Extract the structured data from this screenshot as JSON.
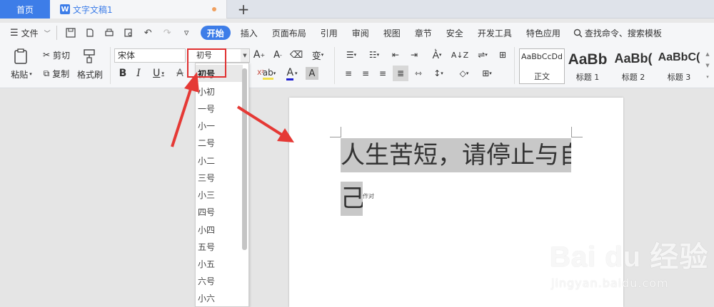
{
  "tabbar": {
    "home_label": "首页",
    "doc_icon_letter": "W",
    "doc_title": "文字文稿1",
    "new_tab_glyph": "+"
  },
  "menubar": {
    "file_label": "文件",
    "items": [
      "开始",
      "插入",
      "页面布局",
      "引用",
      "审阅",
      "视图",
      "章节",
      "安全",
      "开发工具",
      "特色应用"
    ],
    "active_item": "开始",
    "search_label": "查找命令、搜索模板"
  },
  "ribbon": {
    "paste_label": "粘贴",
    "cut_label": "剪切",
    "copy_label": "复制",
    "format_painter_label": "格式刷",
    "font_name": "宋体",
    "font_size": "初号",
    "styles": [
      {
        "sample": "AaBbCcDd",
        "name": "正文"
      },
      {
        "sample": "AaBb",
        "name": "标题 1"
      },
      {
        "sample": "AaBb(",
        "name": "标题 2"
      },
      {
        "sample": "AaBbC(",
        "name": "标题 3"
      }
    ]
  },
  "font_size_dropdown": {
    "options": [
      "初号",
      "小初",
      "一号",
      "小一",
      "二号",
      "小二",
      "三号",
      "小三",
      "四号",
      "小四",
      "五号",
      "小五",
      "六号",
      "小六"
    ],
    "selected": "初号"
  },
  "document": {
    "line1": "人生苦短，请停止与自",
    "line2": "己",
    "small_tag": "作对"
  },
  "watermark": {
    "brand": "Bai du 经验",
    "url": "jingyan.baidu.com"
  },
  "colors": {
    "accent": "#3d7de8",
    "annotation_red": "#e03030",
    "selection_gray": "#c8c8c8"
  }
}
